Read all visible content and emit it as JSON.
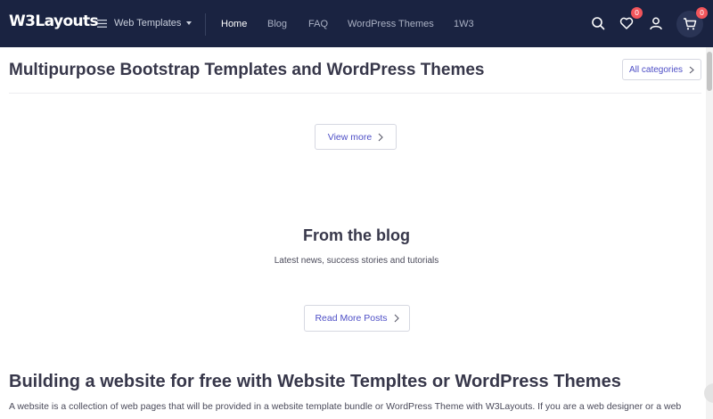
{
  "header": {
    "logo": "W3Layouts",
    "templates_dropdown": "Web Templates",
    "nav": [
      "Home",
      "Blog",
      "FAQ",
      "WordPress Themes",
      "1W3"
    ],
    "wishlist_count": "0",
    "cart_count": "0",
    "icons": [
      "menu-icon",
      "search-icon",
      "heart-icon",
      "user-icon",
      "cart-icon"
    ]
  },
  "section_templates": {
    "title": "Multipurpose Bootstrap Templates and WordPress Themes",
    "all_categories": "All categories",
    "view_more": "View more"
  },
  "section_blog": {
    "title": "From the blog",
    "subtitle": "Latest news, success stories and tutorials",
    "read_more": "Read More Posts"
  },
  "section_about": {
    "title": "Building a website for free with Website Templtes or WordPress Themes",
    "paragraph": "A website is a collection of web pages that will be provided in a website template bundle or WordPress Theme with W3Layouts. If you are a web designer or a web"
  },
  "colors": {
    "header_bg": "#1a2341",
    "accent": "#4d4ec6",
    "badge": "#f2555b"
  }
}
